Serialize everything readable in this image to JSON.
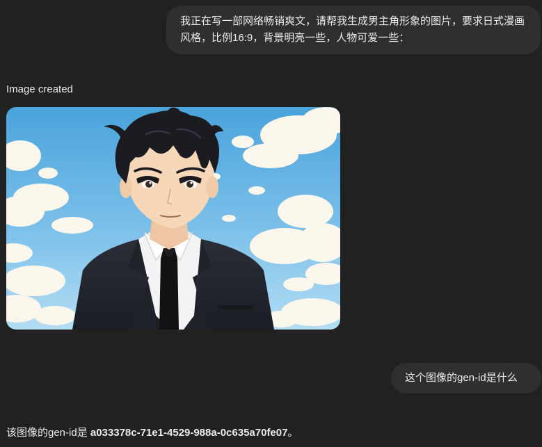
{
  "messages": {
    "user_prompt": "我正在写一部网络畅销爽文，请帮我生成男主角形象的图片，要求日式漫画风格，比例16:9，背景明亮一些，人物可爱一些：",
    "image_status": "Image created",
    "user_question": "这个图像的gen-id是什么",
    "reply_prefix": "该图像的gen-id是 ",
    "reply_gen_id": "a033378c-71e1-4529-988a-0c635a70fe07",
    "reply_suffix": "。"
  },
  "image": {
    "subject": "anime-style young man with black hair in dark suit, white shirt and black tie",
    "background": "bright blue sky with white clouds",
    "colors": {
      "sky_top": "#4fa6dc",
      "sky_bottom": "#a9d8f2",
      "cloud": "#fbf7ec",
      "hair": "#1b1b22",
      "skin": "#f6d7b8",
      "suit": "#24262e",
      "shirt": "#f3f3f5",
      "tie": "#111114"
    }
  }
}
